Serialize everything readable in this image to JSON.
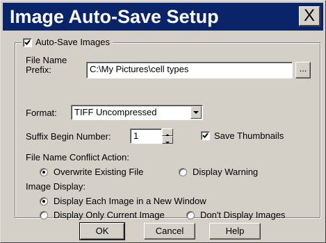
{
  "window": {
    "title": "Image Auto-Save Setup",
    "close_glyph": "X"
  },
  "group": {
    "label": "Auto-Save Images",
    "checked": true
  },
  "file_name": {
    "label_line1": "File Name",
    "label_line2": "Prefix:",
    "value": "C:\\My Pictures\\cell types",
    "browse_label": "..."
  },
  "format": {
    "label": "Format:",
    "selected": "TIFF Uncompressed"
  },
  "suffix": {
    "label": "Suffix Begin Number:",
    "value": "1"
  },
  "thumbnails": {
    "label": "Save Thumbnails",
    "checked": true
  },
  "conflict": {
    "label": "File Name Conflict Action:",
    "options": [
      {
        "label": "Overwrite Existing File",
        "selected": true
      },
      {
        "label": "Display Warning",
        "selected": false
      }
    ]
  },
  "display": {
    "label": "Image Display:",
    "options": [
      {
        "label": "Display Each Image in a New Window",
        "selected": true
      },
      {
        "label": "Display Only Current Image",
        "selected": false
      },
      {
        "label": "Don't Display Images",
        "selected": false
      }
    ]
  },
  "buttons": {
    "ok": "OK",
    "cancel": "Cancel",
    "help": "Help"
  },
  "colors": {
    "title_bar": "#0a246a",
    "face": "#d4d0c8"
  }
}
